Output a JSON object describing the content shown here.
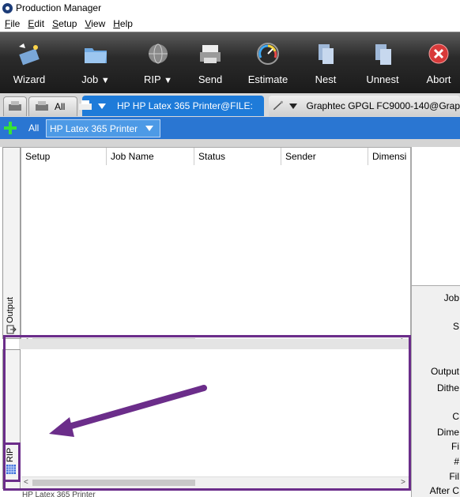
{
  "window": {
    "title": "Production Manager"
  },
  "menu": [
    "File",
    "Edit",
    "Setup",
    "View",
    "Help"
  ],
  "toolbar": {
    "buttons": [
      {
        "label": "Wizard",
        "icon": "wizard-icon"
      },
      {
        "label": "Job",
        "icon": "folder-icon",
        "dropdown": true
      },
      {
        "label": "RIP",
        "icon": "globe-icon",
        "dropdown": true
      },
      {
        "label": "Send",
        "icon": "printer-icon"
      },
      {
        "label": "Estimate",
        "icon": "gauge-icon"
      },
      {
        "label": "Nest",
        "icon": "nest-icon"
      },
      {
        "label": "Unnest",
        "icon": "unnest-icon"
      },
      {
        "label": "Abort",
        "icon": "abort-icon"
      }
    ],
    "caret": "▼"
  },
  "tabs": {
    "all_label": "All",
    "active": "HP HP Latex 365 Printer@FILE:",
    "inactive": "Graphtec GPGL FC9000-140@Grap"
  },
  "filter": {
    "all": "All",
    "printer": "HP Latex 365 Printer"
  },
  "columns": [
    "Setup",
    "Job Name",
    "Status",
    "Sender",
    "Dimensi"
  ],
  "side_labels": {
    "output": "Output",
    "rip": "RIP"
  },
  "right_panel_labels": [
    "Job",
    "S",
    "Output",
    "Dithe",
    "C",
    "Dime",
    "Fi",
    "#",
    "Fil",
    "After C"
  ],
  "colors": {
    "highlight": "#6b2d8a",
    "tab_active": "#1e7bd9",
    "filter_bar": "#2a76d2"
  },
  "bottom_partial_text": "HP Latex 365 Printer"
}
